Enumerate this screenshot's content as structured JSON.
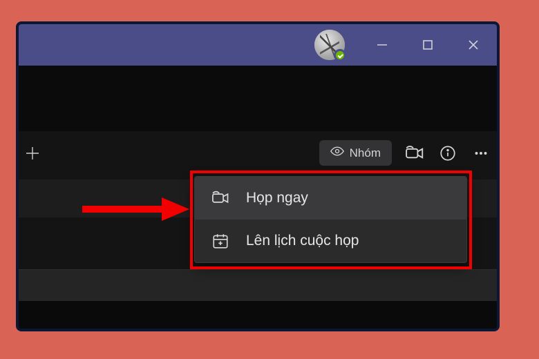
{
  "toolbar": {
    "group_label": "Nhóm"
  },
  "dropdown": {
    "meet_now": "Họp ngay",
    "schedule": "Lên lịch cuộc họp"
  },
  "colors": {
    "bg": "#d96354",
    "highlight": "#f20000",
    "titlebar": "#4a4d87"
  }
}
